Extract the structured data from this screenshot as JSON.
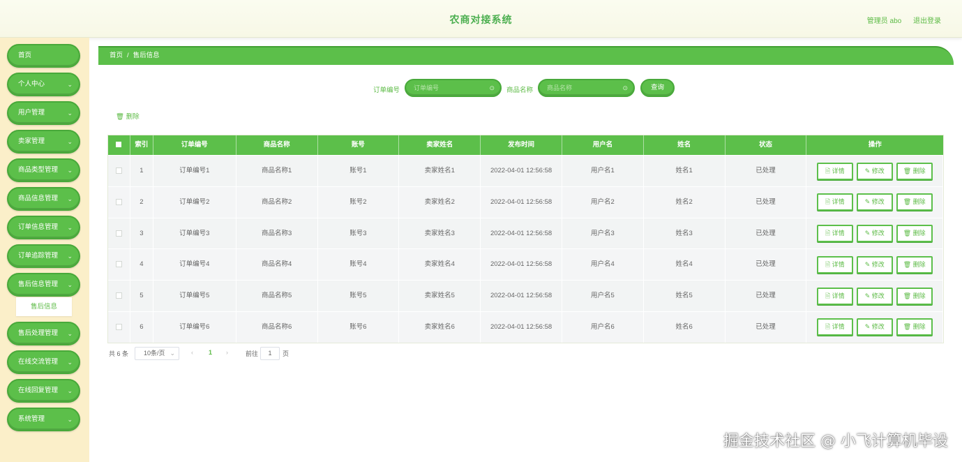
{
  "header": {
    "title": "农商对接系统",
    "admin_label": "管理员 abo",
    "logout_label": "退出登录"
  },
  "sidebar": {
    "items": [
      {
        "label": "首页",
        "has_chevron": false
      },
      {
        "label": "个人中心",
        "has_chevron": true
      },
      {
        "label": "用户管理",
        "has_chevron": true
      },
      {
        "label": "卖家管理",
        "has_chevron": true
      },
      {
        "label": "商品类型管理",
        "has_chevron": true
      },
      {
        "label": "商品信息管理",
        "has_chevron": true
      },
      {
        "label": "订单信息管理",
        "has_chevron": true
      },
      {
        "label": "订单追踪管理",
        "has_chevron": true
      },
      {
        "label": "售后信息管理",
        "has_chevron": true
      },
      {
        "label": "售后处理管理",
        "has_chevron": true
      },
      {
        "label": "在线交流管理",
        "has_chevron": true
      },
      {
        "label": "在线回复管理",
        "has_chevron": true
      },
      {
        "label": "系统管理",
        "has_chevron": true
      }
    ],
    "submenu_label": "售后信息"
  },
  "breadcrumb": {
    "home": "首页",
    "separator": "/",
    "current": "售后信息"
  },
  "search": {
    "order_label": "订单编号",
    "order_placeholder": "订单编号",
    "product_label": "商品名称",
    "product_placeholder": "商品名称",
    "query_button": "查询"
  },
  "toolbar": {
    "delete_label": "删除"
  },
  "table": {
    "columns": [
      "",
      "索引",
      "订单编号",
      "商品名称",
      "账号",
      "卖家姓名",
      "发布时间",
      "用户名",
      "姓名",
      "状态",
      "操作"
    ],
    "rows": [
      [
        "1",
        "订单编号1",
        "商品名称1",
        "账号1",
        "卖家姓名1",
        "2022-04-01 12:56:58",
        "用户名1",
        "姓名1",
        "已处理"
      ],
      [
        "2",
        "订单编号2",
        "商品名称2",
        "账号2",
        "卖家姓名2",
        "2022-04-01 12:56:58",
        "用户名2",
        "姓名2",
        "已处理"
      ],
      [
        "3",
        "订单编号3",
        "商品名称3",
        "账号3",
        "卖家姓名3",
        "2022-04-01 12:56:58",
        "用户名3",
        "姓名3",
        "已处理"
      ],
      [
        "4",
        "订单编号4",
        "商品名称4",
        "账号4",
        "卖家姓名4",
        "2022-04-01 12:56:58",
        "用户名4",
        "姓名4",
        "已处理"
      ],
      [
        "5",
        "订单编号5",
        "商品名称5",
        "账号5",
        "卖家姓名5",
        "2022-04-01 12:56:58",
        "用户名5",
        "姓名5",
        "已处理"
      ],
      [
        "6",
        "订单编号6",
        "商品名称6",
        "账号6",
        "卖家姓名6",
        "2022-04-01 12:56:58",
        "用户名6",
        "姓名6",
        "已处理"
      ]
    ],
    "actions": {
      "detail": "详情",
      "edit": "修改",
      "delete": "删除"
    }
  },
  "pagination": {
    "total": "共 6 条",
    "page_size": "10条/页",
    "prev": "‹",
    "current_page": "1",
    "next": "›",
    "goto_label": "前往",
    "goto_value": "1",
    "page_suffix": "页"
  },
  "watermark": "掘金技术社区 @ 小飞计算机毕设",
  "colors": {
    "accent": "#5cbf4a",
    "accent_dark": "#48a93a",
    "sidebar_bg": "#fbefc9"
  }
}
